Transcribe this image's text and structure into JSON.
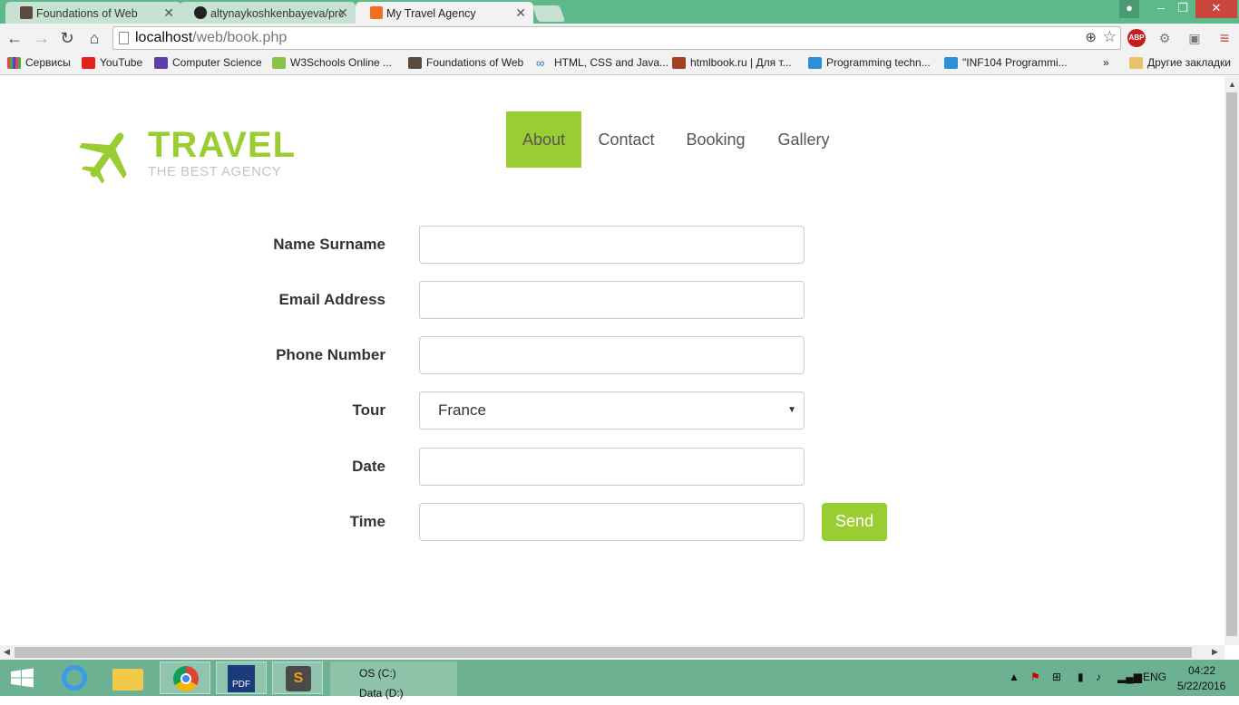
{
  "browser": {
    "tabs": [
      {
        "title": "Foundations of Web",
        "active": false
      },
      {
        "title": "altynaykoshkenbayeva/prc",
        "active": false
      },
      {
        "title": "My Travel Agency",
        "active": true
      }
    ],
    "url_host": "localhost",
    "url_path": "/web/book.php",
    "bookmarks": [
      "Сервисы",
      "YouTube",
      "Computer Science",
      "W3Schools Online ...",
      "Foundations of Web",
      "HTML, CSS and Java...",
      "htmlbook.ru | Для т...",
      "Programming techn...",
      "\"INF104 Programmi...",
      "Другие закладки"
    ],
    "overflow_label": "»",
    "ext_abp": "ABP"
  },
  "site": {
    "logo_title": "TRAVEL",
    "logo_subtitle": "THE BEST AGENCY",
    "nav": [
      "About",
      "Contact",
      "Booking",
      "Gallery"
    ],
    "active_nav": "About",
    "accent_color": "#9acd32"
  },
  "form": {
    "labels": {
      "name": "Name Surname",
      "email": "Email Address",
      "phone": "Phone Number",
      "tour": "Tour",
      "date": "Date",
      "time": "Time"
    },
    "values": {
      "name": "",
      "email": "",
      "phone": "",
      "tour": "France",
      "date": "",
      "time": ""
    },
    "send_label": "Send"
  },
  "taskbar": {
    "drive_c": "OS (C:)",
    "drive_d": "Data (D:)",
    "lang": "ENG",
    "time": "04:22",
    "date": "5/22/2016",
    "pdf_label": "PDF",
    "sublime_label": "S"
  }
}
